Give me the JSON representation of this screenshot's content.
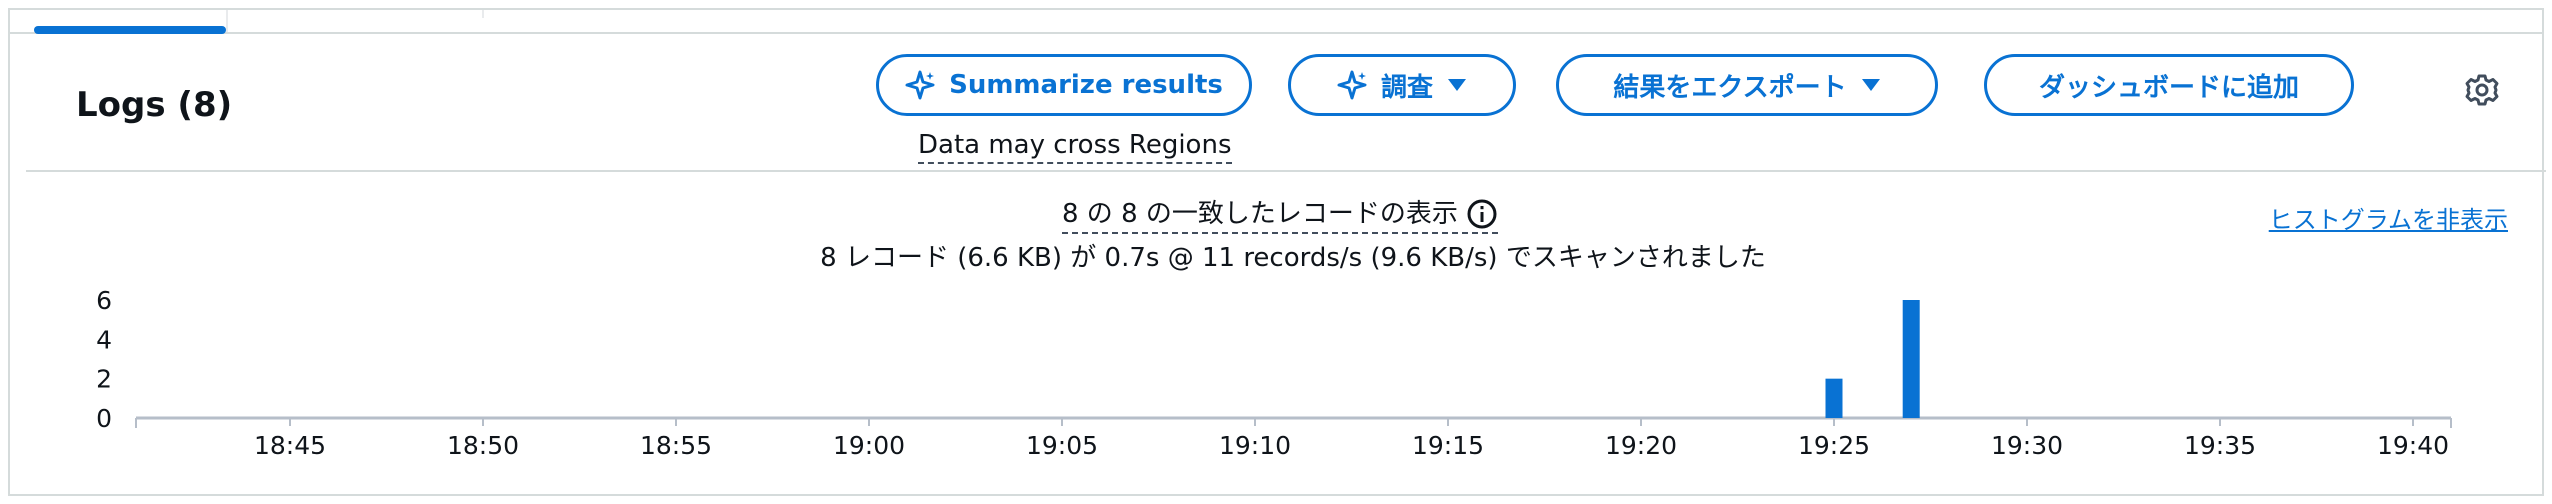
{
  "panel": {
    "title": "Logs (8)",
    "buttons": {
      "summarize": "Summarize results",
      "investigate": "調査",
      "export": "結果をエクスポート",
      "add_dashboard": "ダッシュボードに追加"
    },
    "cross_region_note": "Data may cross Regions",
    "icons": [
      "sparkle-icon",
      "caret-down-icon",
      "gear-icon",
      "info-icon"
    ],
    "accent_color": "#0972d3"
  },
  "histogram": {
    "matched_text": "8 の 8 の一致したレコードの表示",
    "scan_text": "8 レコード (6.6 KB) が 0.7s @ 11 records/s (9.6 KB/s) でスキャンされました",
    "hide_link": "ヒストグラムを非表示"
  },
  "chart_data": {
    "type": "bar",
    "y_ticks": [
      "0",
      "2",
      "4",
      "6"
    ],
    "ylim": [
      0,
      6
    ],
    "x_ticks": [
      "18:45",
      "18:50",
      "18:55",
      "19:00",
      "19:05",
      "19:10",
      "19:15",
      "19:20",
      "19:25",
      "19:30",
      "19:35",
      "19:40"
    ],
    "x": [
      "19:25",
      "19:27"
    ],
    "values": [
      2,
      6
    ],
    "bar_color": "#0972d3"
  }
}
